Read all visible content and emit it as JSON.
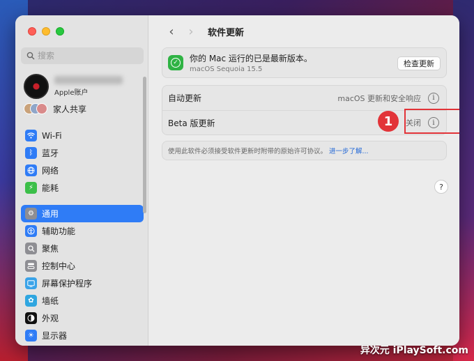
{
  "sidebar": {
    "search_placeholder": "搜索",
    "account_sub": "Apple账户",
    "family_label": "家人共享",
    "items": [
      {
        "label": "Wi-Fi",
        "icon": "wifi-icon",
        "color": "#2f7cf6"
      },
      {
        "label": "蓝牙",
        "icon": "bluetooth-icon",
        "color": "#2f7cf6"
      },
      {
        "label": "网络",
        "icon": "globe-icon",
        "color": "#2f7cf6"
      },
      {
        "label": "能耗",
        "icon": "battery-icon",
        "color": "#3cbf49"
      },
      {
        "label": "通用",
        "icon": "gear-icon",
        "color": "#8e8e93"
      },
      {
        "label": "辅助功能",
        "icon": "accessibility-icon",
        "color": "#2f7cf6"
      },
      {
        "label": "聚焦",
        "icon": "spotlight-icon",
        "color": "#8e8e93"
      },
      {
        "label": "控制中心",
        "icon": "control-center-icon",
        "color": "#8e8e93"
      },
      {
        "label": "屏幕保护程序",
        "icon": "screensaver-icon",
        "color": "#3aa3e8"
      },
      {
        "label": "墙纸",
        "icon": "wallpaper-icon",
        "color": "#2fa6e0"
      },
      {
        "label": "外观",
        "icon": "appearance-icon",
        "color": "#111111"
      },
      {
        "label": "显示器",
        "icon": "display-icon",
        "color": "#2f7cf6"
      }
    ],
    "active_index": 4
  },
  "main": {
    "title": "软件更新",
    "status_main": "你的 Mac 运行的已是最新版本。",
    "status_sub": "macOS Sequoia 15.5",
    "check_button": "检查更新",
    "auto_update_label": "自动更新",
    "auto_update_value": "macOS 更新和安全响应",
    "beta_label": "Beta 版更新",
    "beta_value": "关闭",
    "license_text": "使用此软件必须接受软件更新时附带的原始许可协议。",
    "license_link": "进一步了解...",
    "help_label": "?"
  },
  "annotation": {
    "number": "1"
  },
  "watermark": "异次元 iPlaySoft.com"
}
